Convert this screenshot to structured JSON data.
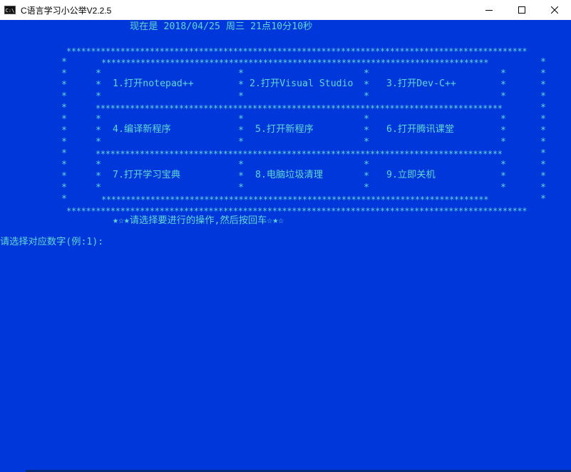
{
  "window": {
    "icon": "C:\\",
    "title": "C语言学习小公举V2.2.5",
    "icon_name": "console-icon"
  },
  "console": {
    "datetime": "现在是 2018/04/25 周三 21点10分10秒",
    "border_outer_top": "**********************************************************************************************",
    "border_inner": "***********************************************************************************",
    "border_inner_b": "*******************************************************************************",
    "menu": {
      "row1": [
        "1.打开notepad++",
        "2.打开Visual Studio",
        "3.打开Dev-C++"
      ],
      "row2": [
        "4.编译新程序",
        "5.打开新程序",
        "6.打开腾讯课堂"
      ],
      "row3": [
        "7.打开学习宝典",
        "8.电脑垃圾清理",
        "9.立即关机"
      ]
    },
    "hint": "★☆★请选择要进行的操作,然后按回车☆★☆",
    "prompt": "请选择对应数字(例:1):"
  },
  "colors": {
    "console_bg": "#0037da",
    "console_fg": "#61d6d6"
  }
}
